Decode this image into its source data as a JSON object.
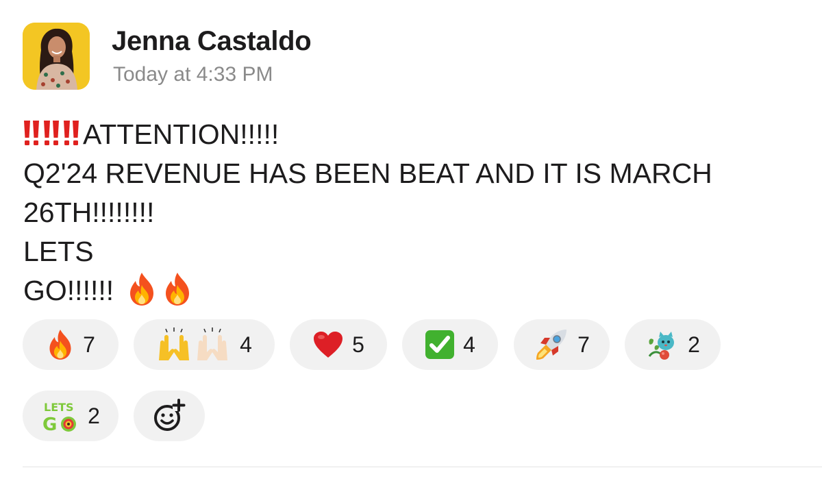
{
  "message": {
    "author": "Jenna Castaldo",
    "timestamp": "Today at 4:33 PM",
    "lines": [
      "ATTENTION!!!!!",
      "Q2'24 REVENUE HAS BEEN BEAT AND IT IS MARCH",
      "26TH!!!!!!!!",
      "LETS",
      "GO!!!!!!"
    ],
    "inline_emoji": [
      "double-exclamation",
      "double-exclamation",
      "double-exclamation",
      "fire",
      "fire"
    ]
  },
  "reactions": [
    {
      "emoji": "fire",
      "count": "7"
    },
    {
      "emoji": "raised-hands",
      "count": "4"
    },
    {
      "emoji": "red-heart",
      "count": "5"
    },
    {
      "emoji": "check-mark-button",
      "count": "4"
    },
    {
      "emoji": "rocket",
      "count": "7"
    },
    {
      "emoji": "cat-with-plant",
      "count": "2"
    },
    {
      "emoji": "lets-go",
      "count": "2",
      "emoji_text": [
        "LETS",
        "GO"
      ]
    }
  ],
  "colors": {
    "avatar_bg": "#f3c623",
    "pill_bg": "#f1f1f1",
    "timestamp": "#8a8a8a",
    "bang_red": "#e0211f"
  }
}
